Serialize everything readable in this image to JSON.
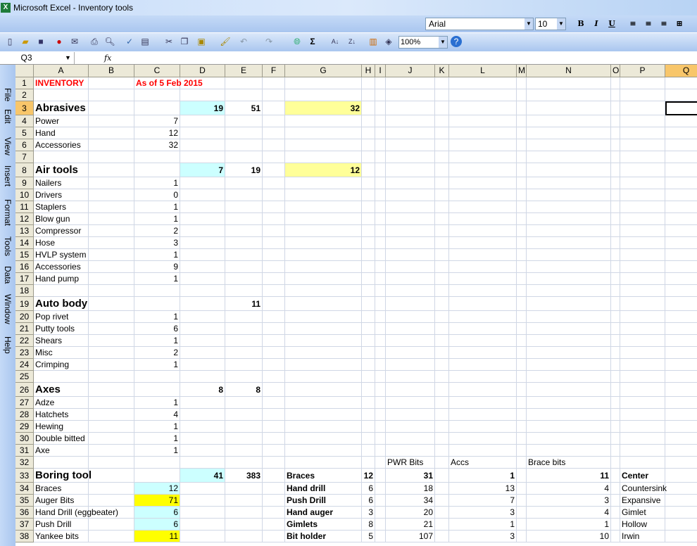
{
  "window": {
    "title": "Microsoft Excel - Inventory tools"
  },
  "format_toolbar": {
    "font": "Arial",
    "size": "10",
    "bold": "B",
    "italic": "I",
    "underline": "U"
  },
  "standard_toolbar": {
    "zoom": "100%",
    "sum": "Σ"
  },
  "formula_bar": {
    "name_box": "Q3",
    "fx": "fx",
    "formula": ""
  },
  "menu": [
    "File",
    "Edit",
    "View",
    "Insert",
    "Format",
    "Tools",
    "Data",
    "Window",
    "Help"
  ],
  "colors": {
    "cyan": "#ccffff",
    "light_yellow": "#ffff99",
    "yellow": "#ffff00",
    "red": "#ff0000",
    "selected_header": "#f8c66a"
  },
  "columns": [
    "A",
    "B",
    "C",
    "D",
    "E",
    "F",
    "G",
    "H",
    "I",
    "J",
    "K",
    "L",
    "M",
    "N",
    "O",
    "P",
    "Q"
  ],
  "selected_cell": "Q3",
  "rows": [
    {
      "n": "1",
      "cells": {
        "A": "INVENTORY",
        "C": "As of 5 Feb 2015"
      }
    },
    {
      "n": "2",
      "cells": {}
    },
    {
      "n": "3",
      "cells": {
        "A": "Abrasives",
        "D": "19",
        "E": "51",
        "G": "32"
      }
    },
    {
      "n": "4",
      "cells": {
        "A": "Power",
        "C": "7"
      }
    },
    {
      "n": "5",
      "cells": {
        "A": "Hand",
        "C": "12"
      }
    },
    {
      "n": "6",
      "cells": {
        "A": "Accessories",
        "C": "32"
      }
    },
    {
      "n": "7",
      "cells": {}
    },
    {
      "n": "8",
      "cells": {
        "A": "Air tools",
        "D": "7",
        "E": "19",
        "G": "12"
      }
    },
    {
      "n": "9",
      "cells": {
        "A": "Nailers",
        "C": "1"
      }
    },
    {
      "n": "10",
      "cells": {
        "A": "Drivers",
        "C": "0"
      }
    },
    {
      "n": "11",
      "cells": {
        "A": "Staplers",
        "C": "1"
      }
    },
    {
      "n": "12",
      "cells": {
        "A": "Blow gun",
        "C": "1"
      }
    },
    {
      "n": "13",
      "cells": {
        "A": "Compressor",
        "C": "2"
      }
    },
    {
      "n": "14",
      "cells": {
        "A": "Hose",
        "C": "3"
      }
    },
    {
      "n": "15",
      "cells": {
        "A": "HVLP system",
        "C": "1"
      }
    },
    {
      "n": "16",
      "cells": {
        "A": "Accessories",
        "C": "9"
      }
    },
    {
      "n": "17",
      "cells": {
        "A": "Hand pump",
        "C": "1"
      }
    },
    {
      "n": "18",
      "cells": {}
    },
    {
      "n": "19",
      "cells": {
        "A": "Auto body",
        "E": "11"
      }
    },
    {
      "n": "20",
      "cells": {
        "A": "Pop rivet",
        "C": "1"
      }
    },
    {
      "n": "21",
      "cells": {
        "A": "Putty tools",
        "C": "6"
      }
    },
    {
      "n": "22",
      "cells": {
        "A": "Shears",
        "C": "1"
      }
    },
    {
      "n": "23",
      "cells": {
        "A": "Misc",
        "C": "2"
      }
    },
    {
      "n": "24",
      "cells": {
        "A": "Crimping",
        "C": "1"
      }
    },
    {
      "n": "25",
      "cells": {}
    },
    {
      "n": "26",
      "cells": {
        "A": "Axes",
        "D": "8",
        "E": "8"
      }
    },
    {
      "n": "27",
      "cells": {
        "A": "Adze",
        "C": "1"
      }
    },
    {
      "n": "28",
      "cells": {
        "A": "Hatchets",
        "C": "4"
      }
    },
    {
      "n": "29",
      "cells": {
        "A": "Hewing",
        "C": "1"
      }
    },
    {
      "n": "30",
      "cells": {
        "A": "Double bitted",
        "C": "1"
      }
    },
    {
      "n": "31",
      "cells": {
        "A": "Axe",
        "C": "1"
      }
    },
    {
      "n": "32",
      "cells": {
        "J": "PWR Bits",
        "L": "Accs",
        "N": "Brace bits"
      }
    },
    {
      "n": "33",
      "cells": {
        "A": "Boring tool",
        "D": "41",
        "E": "383",
        "G": "Braces",
        "H": "12",
        "J": "31",
        "L": "1",
        "N": "11",
        "P": "Center"
      }
    },
    {
      "n": "34",
      "cells": {
        "A": "Braces",
        "C": "12",
        "G": "Hand drill",
        "H": "6",
        "J": "18",
        "L": "13",
        "N": "4",
        "P": "Countersink"
      }
    },
    {
      "n": "35",
      "cells": {
        "A": "Auger Bits",
        "C": "71",
        "G": "Push Drill",
        "H": "6",
        "J": "34",
        "L": "7",
        "N": "3",
        "P": "Expansive"
      }
    },
    {
      "n": "36",
      "cells": {
        "A": "Hand Drill (eggbeater)",
        "C": "6",
        "G": "Hand auger",
        "H": "3",
        "J": "20",
        "L": "3",
        "N": "4",
        "P": "Gimlet"
      }
    },
    {
      "n": "37",
      "cells": {
        "A": "Push Drill",
        "C": "6",
        "G": "Gimlets",
        "H": "8",
        "J": "21",
        "L": "1",
        "N": "1",
        "P": "Hollow"
      }
    },
    {
      "n": "38",
      "cells": {
        "A": "Yankee bits",
        "C": "11",
        "G": "Bit holder",
        "H": "5",
        "J": "107",
        "L": "3",
        "N": "10",
        "P": "Irwin"
      }
    }
  ]
}
